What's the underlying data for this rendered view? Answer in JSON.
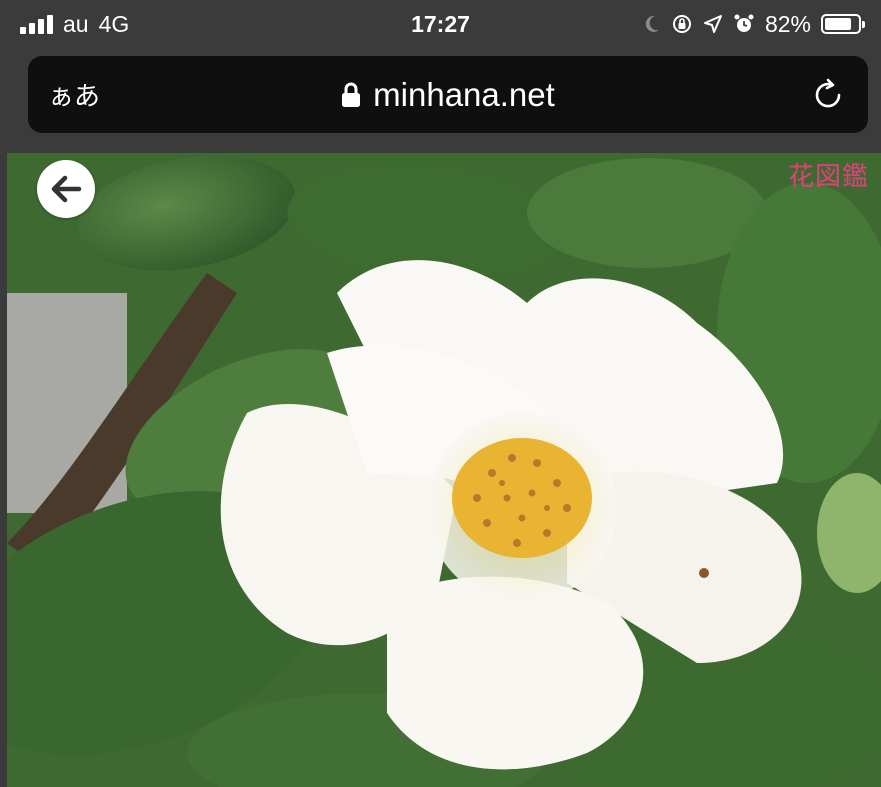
{
  "status_bar": {
    "carrier": "au",
    "network": "4G",
    "time": "17:27",
    "battery_percent": "82%",
    "battery_level": 0.82,
    "icons": [
      "signal-icon",
      "moon-icon",
      "orientation-lock-icon",
      "location-icon",
      "alarm-icon",
      "battery-icon"
    ]
  },
  "url_bar": {
    "text_size_label": "ぁあ",
    "domain": "minhana.net",
    "icons": [
      "lock-icon",
      "reload-icon"
    ]
  },
  "photo": {
    "watermark": "花図鑑",
    "back_icon": "arrow-left-icon",
    "colors": {
      "leaf": "#3f6a32",
      "petal": "#f8f7f2",
      "stamen": "#e8b431",
      "watermark": "#e2407a"
    }
  }
}
